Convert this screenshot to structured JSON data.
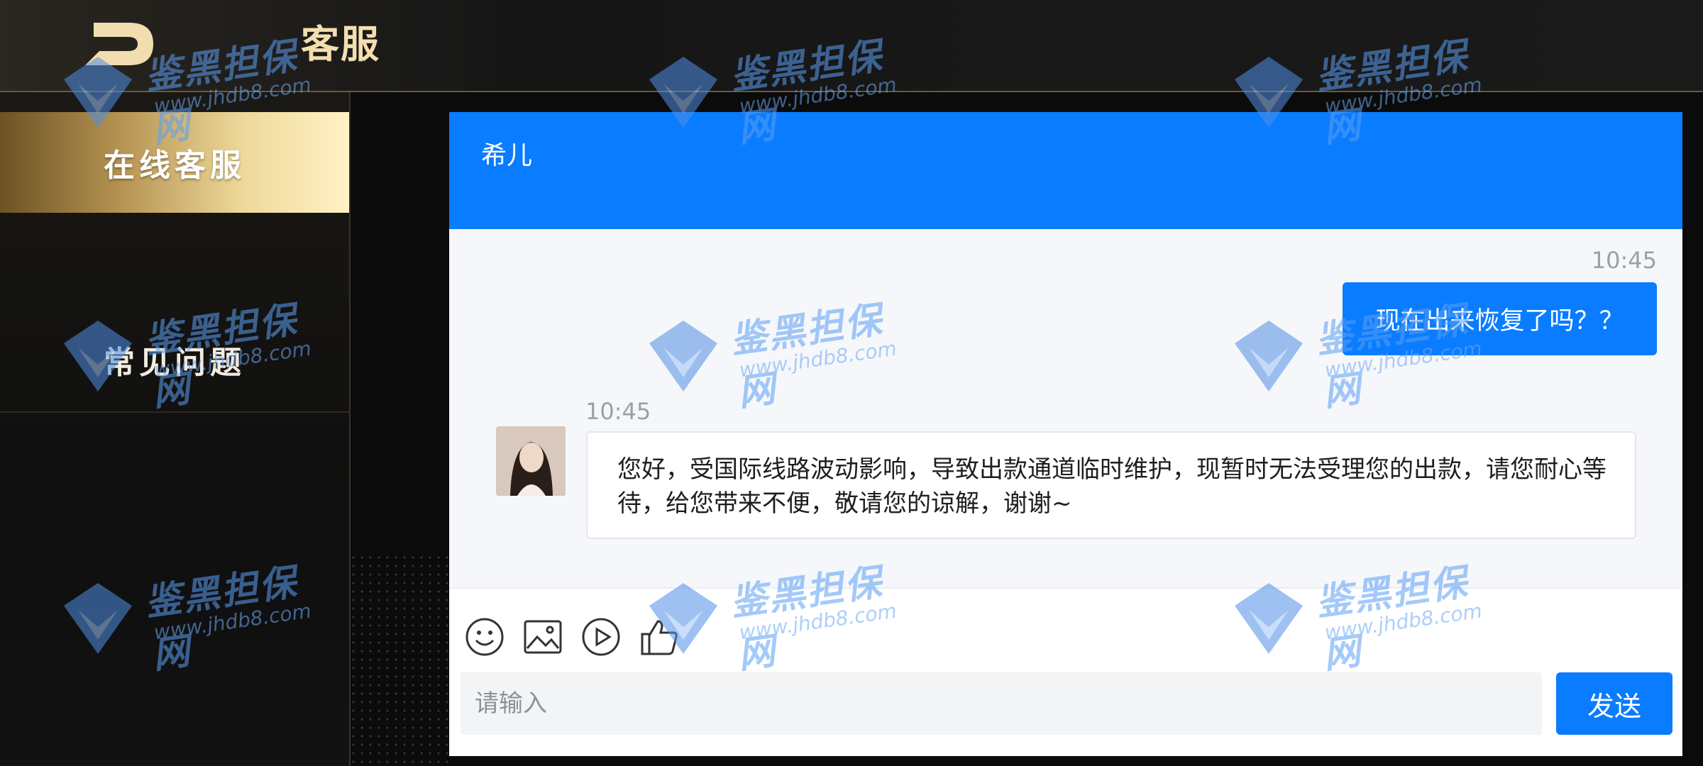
{
  "header": {
    "title": "客服"
  },
  "sidebar": {
    "items": [
      {
        "label": "在线客服",
        "active": true
      },
      {
        "label": "常见问题",
        "active": false
      }
    ]
  },
  "chat": {
    "agent_name": "希儿",
    "messages": [
      {
        "direction": "outgoing",
        "time": "10:45",
        "text": "现在出来恢复了吗？？"
      },
      {
        "direction": "incoming",
        "time": "10:45",
        "text": "您好，受国际线路波动影响，导致出款通道临时维护，现暂时无法受理您的出款，请您耐心等待，给您带来不便，敬请您的谅解，谢谢~"
      }
    ],
    "toolbar": [
      "emoji-icon",
      "image-icon",
      "video-icon",
      "thumbs-up-icon"
    ],
    "input_placeholder": "请输入",
    "send_label": "发送"
  },
  "watermark": {
    "text": "鉴黑担保网",
    "url": "www.jhdb8.com"
  },
  "colors": {
    "accent": "#0a7cff",
    "gold": "#f3dfae",
    "background": "#0b0b0b"
  }
}
